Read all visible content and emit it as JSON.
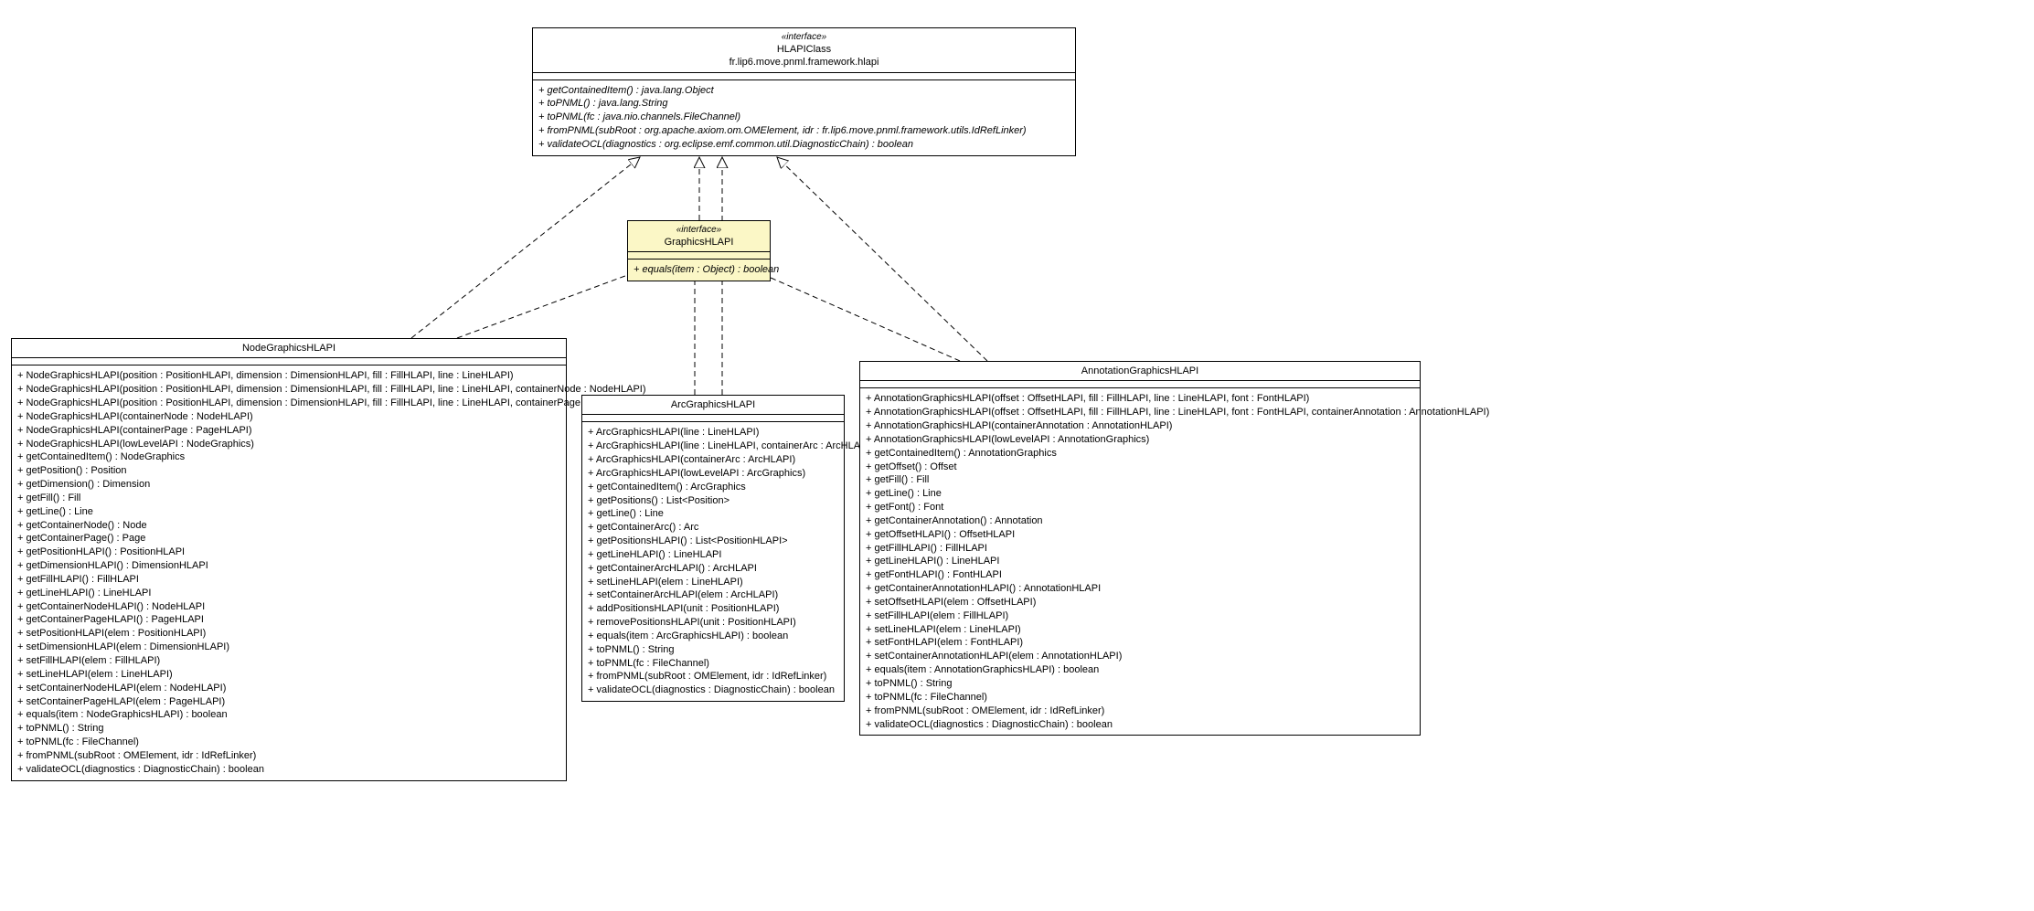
{
  "hlapi": {
    "stereotype": "«interface»",
    "name": "HLAPIClass",
    "package": "fr.lip6.move.pnml.framework.hlapi",
    "methods": [
      "+ getContainedItem() : java.lang.Object",
      "+ toPNML() : java.lang.String",
      "+ toPNML(fc : java.nio.channels.FileChannel)",
      "+ fromPNML(subRoot : org.apache.axiom.om.OMElement, idr : fr.lip6.move.pnml.framework.utils.IdRefLinker)",
      "+ validateOCL(diagnostics : org.eclipse.emf.common.util.DiagnosticChain) : boolean"
    ]
  },
  "graphics": {
    "stereotype": "«interface»",
    "name": "GraphicsHLAPI",
    "methods": [
      "+ equals(item : Object) : boolean"
    ]
  },
  "node": {
    "name": "NodeGraphicsHLAPI",
    "methods": [
      "+ NodeGraphicsHLAPI(position : PositionHLAPI, dimension : DimensionHLAPI, fill : FillHLAPI, line : LineHLAPI)",
      "+ NodeGraphicsHLAPI(position : PositionHLAPI, dimension : DimensionHLAPI, fill : FillHLAPI, line : LineHLAPI, containerNode : NodeHLAPI)",
      "+ NodeGraphicsHLAPI(position : PositionHLAPI, dimension : DimensionHLAPI, fill : FillHLAPI, line : LineHLAPI, containerPage : PageHLAPI)",
      "+ NodeGraphicsHLAPI(containerNode : NodeHLAPI)",
      "+ NodeGraphicsHLAPI(containerPage : PageHLAPI)",
      "+ NodeGraphicsHLAPI(lowLevelAPI : NodeGraphics)",
      "+ getContainedItem() : NodeGraphics",
      "+ getPosition() : Position",
      "+ getDimension() : Dimension",
      "+ getFill() : Fill",
      "+ getLine() : Line",
      "+ getContainerNode() : Node",
      "+ getContainerPage() : Page",
      "+ getPositionHLAPI() : PositionHLAPI",
      "+ getDimensionHLAPI() : DimensionHLAPI",
      "+ getFillHLAPI() : FillHLAPI",
      "+ getLineHLAPI() : LineHLAPI",
      "+ getContainerNodeHLAPI() : NodeHLAPI",
      "+ getContainerPageHLAPI() : PageHLAPI",
      "+ setPositionHLAPI(elem : PositionHLAPI)",
      "+ setDimensionHLAPI(elem : DimensionHLAPI)",
      "+ setFillHLAPI(elem : FillHLAPI)",
      "+ setLineHLAPI(elem : LineHLAPI)",
      "+ setContainerNodeHLAPI(elem : NodeHLAPI)",
      "+ setContainerPageHLAPI(elem : PageHLAPI)",
      "+ equals(item : NodeGraphicsHLAPI) : boolean",
      "+ toPNML() : String",
      "+ toPNML(fc : FileChannel)",
      "+ fromPNML(subRoot : OMElement, idr : IdRefLinker)",
      "+ validateOCL(diagnostics : DiagnosticChain) : boolean"
    ]
  },
  "arc": {
    "name": "ArcGraphicsHLAPI",
    "methods": [
      "+ ArcGraphicsHLAPI(line : LineHLAPI)",
      "+ ArcGraphicsHLAPI(line : LineHLAPI, containerArc : ArcHLAPI)",
      "+ ArcGraphicsHLAPI(containerArc : ArcHLAPI)",
      "+ ArcGraphicsHLAPI(lowLevelAPI : ArcGraphics)",
      "+ getContainedItem() : ArcGraphics",
      "+ getPositions() : List<Position>",
      "+ getLine() : Line",
      "+ getContainerArc() : Arc",
      "+ getPositionsHLAPI() : List<PositionHLAPI>",
      "+ getLineHLAPI() : LineHLAPI",
      "+ getContainerArcHLAPI() : ArcHLAPI",
      "+ setLineHLAPI(elem : LineHLAPI)",
      "+ setContainerArcHLAPI(elem : ArcHLAPI)",
      "+ addPositionsHLAPI(unit : PositionHLAPI)",
      "+ removePositionsHLAPI(unit : PositionHLAPI)",
      "+ equals(item : ArcGraphicsHLAPI) : boolean",
      "+ toPNML() : String",
      "+ toPNML(fc : FileChannel)",
      "+ fromPNML(subRoot : OMElement, idr : IdRefLinker)",
      "+ validateOCL(diagnostics : DiagnosticChain) : boolean"
    ]
  },
  "annotation": {
    "name": "AnnotationGraphicsHLAPI",
    "methods": [
      "+ AnnotationGraphicsHLAPI(offset : OffsetHLAPI, fill : FillHLAPI, line : LineHLAPI, font : FontHLAPI)",
      "+ AnnotationGraphicsHLAPI(offset : OffsetHLAPI, fill : FillHLAPI, line : LineHLAPI, font : FontHLAPI, containerAnnotation : AnnotationHLAPI)",
      "+ AnnotationGraphicsHLAPI(containerAnnotation : AnnotationHLAPI)",
      "+ AnnotationGraphicsHLAPI(lowLevelAPI : AnnotationGraphics)",
      "+ getContainedItem() : AnnotationGraphics",
      "+ getOffset() : Offset",
      "+ getFill() : Fill",
      "+ getLine() : Line",
      "+ getFont() : Font",
      "+ getContainerAnnotation() : Annotation",
      "+ getOffsetHLAPI() : OffsetHLAPI",
      "+ getFillHLAPI() : FillHLAPI",
      "+ getLineHLAPI() : LineHLAPI",
      "+ getFontHLAPI() : FontHLAPI",
      "+ getContainerAnnotationHLAPI() : AnnotationHLAPI",
      "+ setOffsetHLAPI(elem : OffsetHLAPI)",
      "+ setFillHLAPI(elem : FillHLAPI)",
      "+ setLineHLAPI(elem : LineHLAPI)",
      "+ setFontHLAPI(elem : FontHLAPI)",
      "+ setContainerAnnotationHLAPI(elem : AnnotationHLAPI)",
      "+ equals(item : AnnotationGraphicsHLAPI) : boolean",
      "+ toPNML() : String",
      "+ toPNML(fc : FileChannel)",
      "+ fromPNML(subRoot : OMElement, idr : IdRefLinker)",
      "+ validateOCL(diagnostics : DiagnosticChain) : boolean"
    ]
  }
}
